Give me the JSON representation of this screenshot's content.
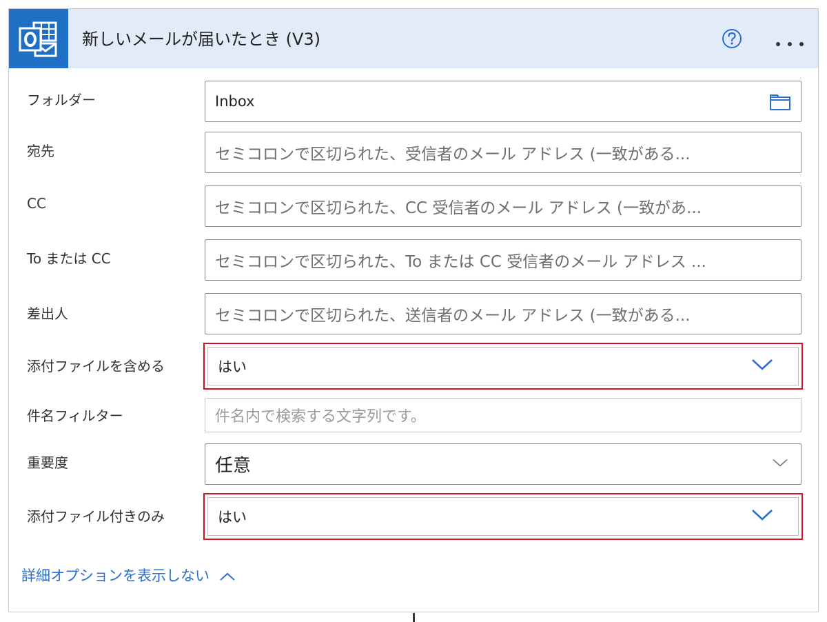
{
  "header": {
    "title": "新しいメールが届いたとき (V3)",
    "app_icon": "outlook-icon",
    "help_icon": "question-circle-icon",
    "more_icon": "ellipsis-icon"
  },
  "fields": {
    "folder": {
      "label": "フォルダー",
      "value": "Inbox",
      "icon": "folder-icon"
    },
    "to": {
      "label": "宛先",
      "placeholder": "セミコロンで区切られた、受信者のメール アドレス (一致がある..."
    },
    "cc": {
      "label": "CC",
      "placeholder": "セミコロンで区切られた、CC 受信者のメール アドレス (一致があ..."
    },
    "to_or_cc": {
      "label": "To または CC",
      "placeholder": "セミコロンで区切られた、To または CC 受信者のメール アドレス ..."
    },
    "from": {
      "label": "差出人",
      "placeholder": "セミコロンで区切られた、送信者のメール アドレス (一致がある..."
    },
    "include_attachments": {
      "label": "添付ファイルを含める",
      "value": "はい"
    },
    "subject_filter": {
      "label": "件名フィルター",
      "placeholder": "件名内で検索する文字列です。"
    },
    "importance": {
      "label": "重要度",
      "value": "任意"
    },
    "only_with_attachments": {
      "label": "添付ファイル付きのみ",
      "value": "はい"
    }
  },
  "advanced": {
    "label": "詳細オプションを表示しない"
  },
  "colors": {
    "header_bg": "#e2ebf8",
    "brand": "#1f6fc5",
    "highlight": "#d9101f",
    "link": "#2c6fcf"
  }
}
